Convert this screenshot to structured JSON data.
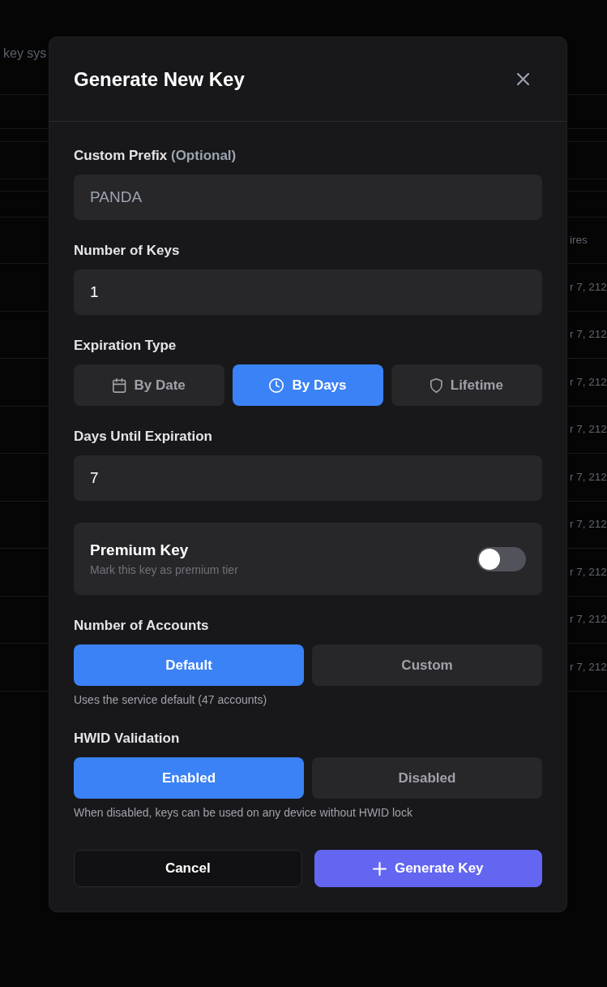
{
  "page": {
    "subtitle": "key sys",
    "table": {
      "columns": [
        "ires"
      ],
      "rows": [
        [
          "r 7, 212"
        ],
        [
          "r 7, 212"
        ],
        [
          "r 7, 212"
        ],
        [
          "r 7, 212"
        ],
        [
          "r 7, 212"
        ],
        [
          "r 7, 212"
        ],
        [
          "r 7, 212"
        ],
        [
          "r 7, 212"
        ],
        [
          "r 7, 212"
        ]
      ]
    }
  },
  "dialog": {
    "title": "Generate New Key",
    "sections": [
      {
        "kind": "text_input",
        "label": "Custom Prefix",
        "label_note": "(Optional)",
        "placeholder": "PANDA"
      },
      {
        "kind": "text_input",
        "label": "Number of Keys",
        "value": "1"
      },
      {
        "kind": "icon_choice",
        "label": "Expiration Type",
        "options": [
          {
            "label": "By Date",
            "selected": false
          },
          {
            "label": "By Days",
            "selected": true
          },
          {
            "label": "Lifetime",
            "selected": false
          }
        ]
      },
      {
        "kind": "text_input",
        "label": "Days Until Expiration",
        "value": "7"
      },
      {
        "kind": "switch",
        "title": "Premium Key",
        "description": "Mark this key as premium tier",
        "on": false
      },
      {
        "kind": "choice",
        "label": "Number of Accounts",
        "options": [
          {
            "label": "Default",
            "selected": true
          },
          {
            "label": "Custom",
            "selected": false
          }
        ],
        "help": "Uses the service default (47 accounts)"
      },
      {
        "kind": "choice",
        "label": "HWID Validation",
        "options": [
          {
            "label": "Enabled",
            "selected": true
          },
          {
            "label": "Disabled",
            "selected": false
          }
        ],
        "help": "When disabled, keys can be used on any device without HWID lock"
      }
    ],
    "buttons": [
      {
        "label": "Cancel",
        "kind": "secondary"
      },
      {
        "label": "Generate Key",
        "kind": "primary"
      }
    ]
  }
}
